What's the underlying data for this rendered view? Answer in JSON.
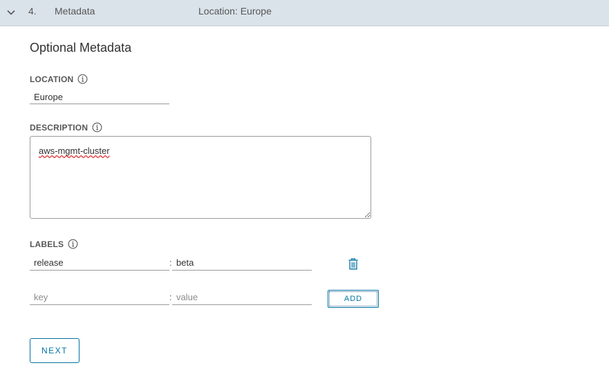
{
  "header": {
    "step_number": "4.",
    "step_title": "Metadata",
    "summary": "Location: Europe",
    "expand_icon": "chevron-down-icon"
  },
  "section": {
    "title": "Optional Metadata"
  },
  "location": {
    "label": "LOCATION",
    "value": "Europe",
    "info_icon": "info-icon"
  },
  "description": {
    "label": "DESCRIPTION",
    "value": "aws-mgmt-cluster",
    "info_icon": "info-icon"
  },
  "labels": {
    "label": "LABELS",
    "info_icon": "info-icon",
    "existing": {
      "key": "release",
      "value": "beta",
      "delete_icon": "trash-icon"
    },
    "new_entry": {
      "key_placeholder": "key",
      "value_placeholder": "value",
      "add_label": "ADD"
    }
  },
  "actions": {
    "next_label": "NEXT"
  },
  "colors": {
    "accent": "#0072a3",
    "header_bg": "#dbe3ea"
  }
}
